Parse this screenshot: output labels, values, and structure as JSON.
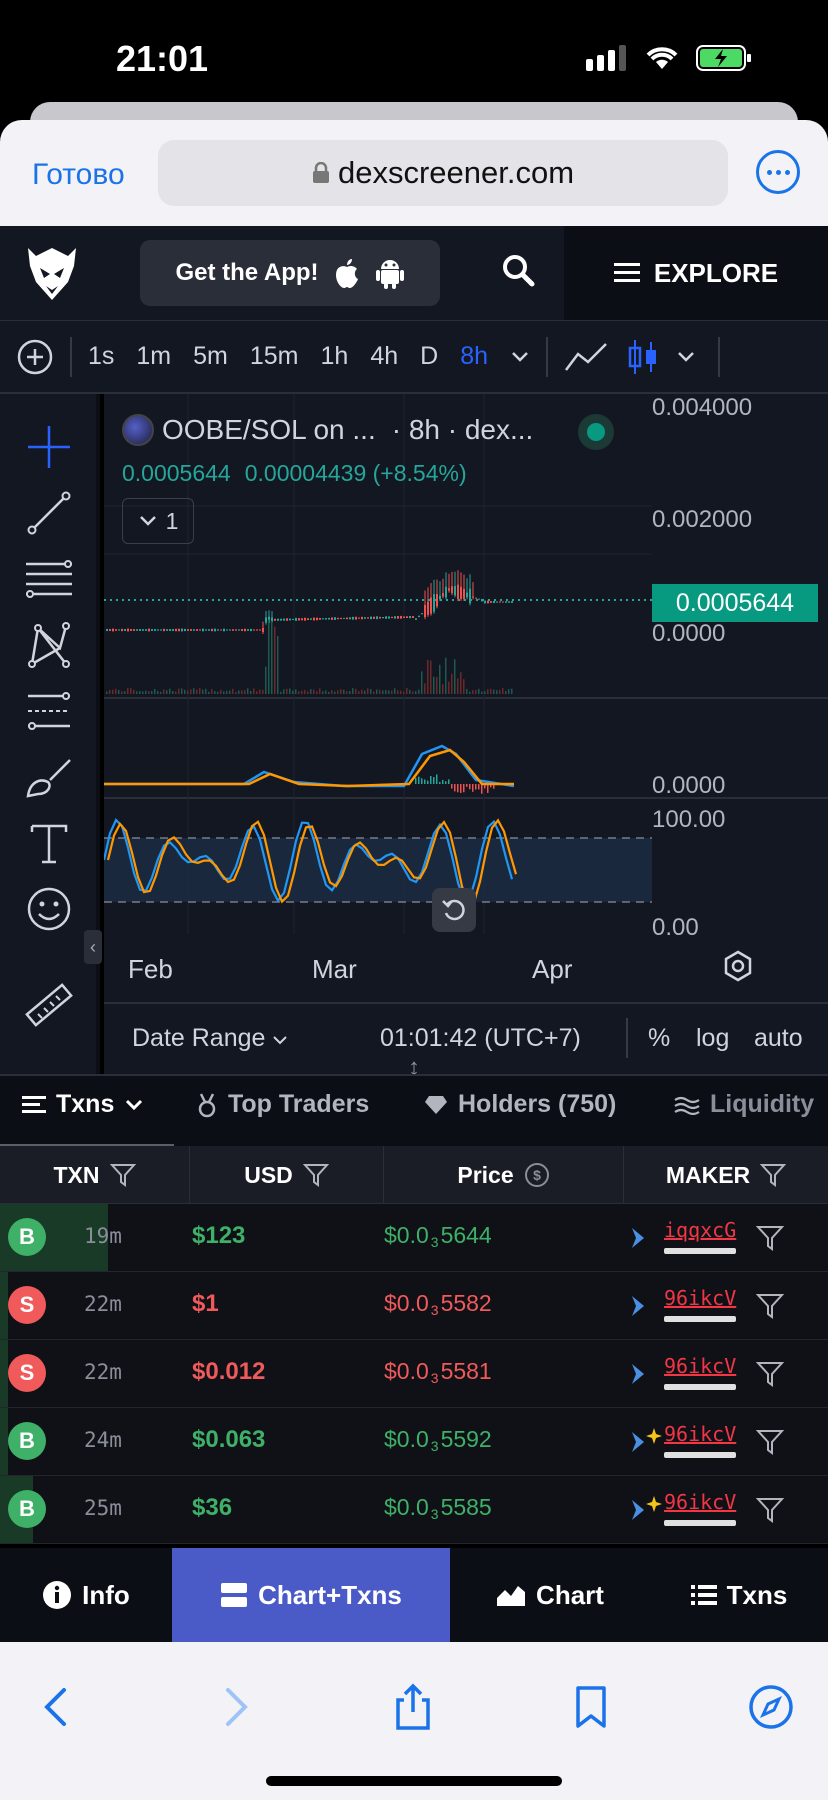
{
  "status_bar": {
    "time": "21:01"
  },
  "safari": {
    "done_label": "Готово",
    "url": "dexscreener.com"
  },
  "site": {
    "get_app_label": "Get the App!",
    "explore_label": "EXPLORE"
  },
  "toolbar": {
    "timeframes": [
      "1s",
      "1m",
      "5m",
      "15m",
      "1h",
      "4h",
      "D",
      "8h"
    ],
    "active_timeframe": "8h"
  },
  "chart": {
    "legend_title": "OOBE/SOL on ...",
    "legend_interval": "· 8h · dex...",
    "legend_price": "0.0005644",
    "legend_change": "0.00004439 (+8.54%)",
    "collapse_count": "1",
    "price_axis_labels": [
      "0.004000",
      "0.002000",
      "0.0000",
      "0.0000",
      "100.00",
      "0.00"
    ],
    "current_price_badge": "0.0005644",
    "x_labels": [
      "Feb",
      "Mar",
      "Apr"
    ],
    "date_range_label": "Date Range",
    "clock": "01:01:42 (UTC+7)",
    "scale_options": [
      "%",
      "log",
      "auto"
    ],
    "colors": {
      "up": "#26a69a",
      "down": "#ef5350",
      "macd": "#2196f3",
      "signal": "#ff9800",
      "accent": "#2962ff"
    }
  },
  "chart_data": {
    "type": "line",
    "title": "OOBE/SOL on ... · 8h · dex...",
    "x_ticks": [
      "Feb",
      "Mar",
      "Apr"
    ],
    "ylim": [
      0,
      0.004
    ],
    "y_ticks": [
      "0.004000",
      "0.002000",
      "0.0000"
    ],
    "current_value": 0.0005644,
    "grid": true
  },
  "tabs": [
    {
      "label": "Txns",
      "active": true
    },
    {
      "label": "Top Traders",
      "active": false
    },
    {
      "label": "Holders (750)",
      "active": false
    },
    {
      "label": "Liquidity",
      "active": false
    }
  ],
  "table": {
    "headers": [
      "TXN",
      "USD",
      "Price",
      "MAKER"
    ],
    "rows": [
      {
        "type": "B",
        "age": "19m",
        "usd": "$123",
        "price_prefix": "$0.0",
        "price_zeros": "3",
        "price_digits": "5644",
        "maker": "iqqxcG",
        "side": "buy",
        "age_fraction": 0.13
      },
      {
        "type": "S",
        "age": "22m",
        "usd": "$1",
        "price_prefix": "$0.0",
        "price_zeros": "3",
        "price_digits": "5582",
        "maker": "96ikcV",
        "side": "sell",
        "age_fraction": 0.01
      },
      {
        "type": "S",
        "age": "22m",
        "usd": "$0.012",
        "price_prefix": "$0.0",
        "price_zeros": "3",
        "price_digits": "5581",
        "maker": "96ikcV",
        "side": "sell",
        "age_fraction": 0.01
      },
      {
        "type": "B",
        "age": "24m",
        "usd": "$0.063",
        "price_prefix": "$0.0",
        "price_zeros": "3",
        "price_digits": "5592",
        "maker": "96ikcV",
        "side": "buy",
        "age_fraction": 0.01
      },
      {
        "type": "B",
        "age": "25m",
        "usd": "$36",
        "price_prefix": "$0.0",
        "price_zeros": "3",
        "price_digits": "5585",
        "maker": "96ikcV",
        "side": "buy",
        "age_fraction": 0.04
      }
    ]
  },
  "bottom_nav": [
    {
      "label": "Info",
      "active": false
    },
    {
      "label": "Chart+Txns",
      "active": true
    },
    {
      "label": "Chart",
      "active": false
    },
    {
      "label": "Txns",
      "active": false
    }
  ]
}
